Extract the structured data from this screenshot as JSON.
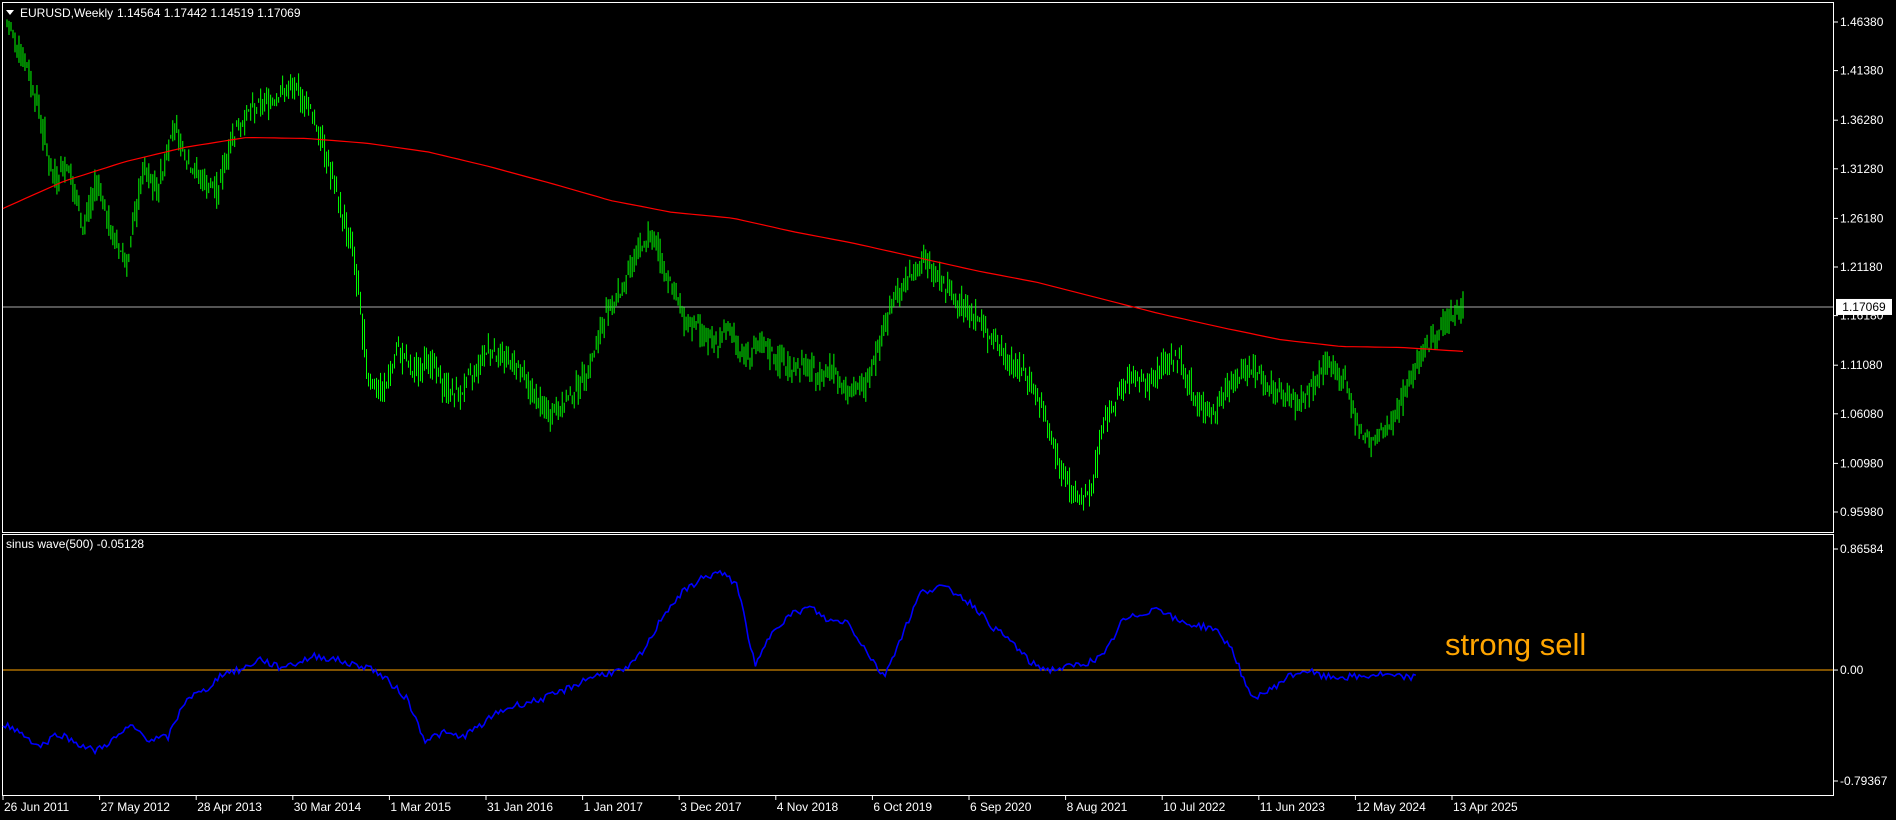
{
  "header": {
    "dropdown_icon": "triangle-down-icon",
    "symbol": "EURUSD,Weekly",
    "ohlc": "1.14564 1.17442 1.14519 1.17069"
  },
  "indicator": {
    "label": "sinus wave(500) -0.05128"
  },
  "current_price_label": "1.17069",
  "annotation": "strong sell",
  "colors": {
    "background": "#000000",
    "candles": "#00ff00",
    "moving_average": "#ff0000",
    "sinus_wave": "#0000ff",
    "zero_line": "#ffa500",
    "current_price_line": "#a9a9a9",
    "annotation": "#ffa500",
    "frame": "#ffffff"
  },
  "chart_data": [
    {
      "type": "line",
      "panel": "price",
      "series": [
        {
          "name": "EURUSD",
          "values": [
            1.46,
            1.43,
            1.38,
            1.3,
            1.32,
            1.25,
            1.3,
            1.24,
            1.22,
            1.31,
            1.29,
            1.36,
            1.32,
            1.3,
            1.29,
            1.35,
            1.37,
            1.38,
            1.39,
            1.395,
            1.38,
            1.34,
            1.28,
            1.23,
            1.1,
            1.08,
            1.13,
            1.1,
            1.12,
            1.09,
            1.08,
            1.1,
            1.13,
            1.12,
            1.11,
            1.08,
            1.06,
            1.07,
            1.09,
            1.12,
            1.17,
            1.19,
            1.23,
            1.245,
            1.2,
            1.16,
            1.15,
            1.13,
            1.15,
            1.12,
            1.13,
            1.12,
            1.11,
            1.11,
            1.1,
            1.11,
            1.08,
            1.09,
            1.13,
            1.18,
            1.2,
            1.22,
            1.2,
            1.18,
            1.17,
            1.15,
            1.13,
            1.11,
            1.1,
            1.06,
            1.01,
            0.98,
            0.97,
            1.05,
            1.08,
            1.1,
            1.09,
            1.11,
            1.12,
            1.08,
            1.06,
            1.08,
            1.1,
            1.11,
            1.09,
            1.08,
            1.07,
            1.09,
            1.11,
            1.1,
            1.04,
            1.03,
            1.05,
            1.08,
            1.12,
            1.14,
            1.16,
            1.17
          ]
        },
        {
          "name": "moving-average",
          "values": [
            1.272,
            1.3,
            1.32,
            1.335,
            1.345,
            1.344,
            1.339,
            1.33,
            1.315,
            1.298,
            1.28,
            1.268,
            1.262,
            1.248,
            1.236,
            1.222,
            1.208,
            1.196,
            1.18,
            1.164,
            1.15,
            1.137,
            1.13,
            1.129,
            1.125
          ]
        }
      ],
      "y_ticks": [
        "1.46380",
        "1.41380",
        "1.36280",
        "1.31280",
        "1.26180",
        "1.21180",
        "1.16180",
        "1.11080",
        "1.06080",
        "1.00980",
        "0.95980"
      ],
      "ylim": [
        0.9598,
        1.4638
      ],
      "current_price": 1.17069,
      "grid": false
    },
    {
      "type": "line",
      "panel": "indicator",
      "series": [
        {
          "name": "sinus wave(500)",
          "values": [
            -0.38,
            -0.45,
            -0.55,
            -0.45,
            -0.52,
            -0.58,
            -0.5,
            -0.4,
            -0.5,
            -0.48,
            -0.2,
            -0.15,
            -0.02,
            0.0,
            0.08,
            0.02,
            0.05,
            0.1,
            0.08,
            0.04,
            0.02,
            -0.08,
            -0.2,
            -0.5,
            -0.45,
            -0.48,
            -0.4,
            -0.3,
            -0.25,
            -0.22,
            -0.18,
            -0.12,
            -0.05,
            -0.02,
            0.0,
            0.15,
            0.4,
            0.55,
            0.65,
            0.7,
            0.62,
            0.02,
            0.3,
            0.4,
            0.45,
            0.35,
            0.35,
            0.15,
            -0.05,
            0.25,
            0.55,
            0.6,
            0.55,
            0.45,
            0.3,
            0.2,
            0.05,
            0.0,
            0.02,
            0.05,
            0.1,
            0.35,
            0.4,
            0.45,
            0.35,
            0.32,
            0.3,
            0.15,
            -0.2,
            -0.15,
            -0.05,
            0.0,
            -0.05,
            -0.05,
            -0.05,
            -0.03,
            -0.05,
            -0.05
          ],
          "x_span": [
            0,
            0.772
          ]
        }
      ],
      "y_ticks": [
        "0.86584",
        "0.00",
        "-0.79367"
      ],
      "ylim": [
        -0.79367,
        0.86584
      ],
      "zero_line": 0.0,
      "grid": false
    }
  ],
  "x_axis_labels": [
    "26 Jun 2011",
    "27 May 2012",
    "28 Apr 2013",
    "30 Mar 2014",
    "1 Mar 2015",
    "31 Jan 2016",
    "1 Jan 2017",
    "3 Dec 2017",
    "4 Nov 2018",
    "6 Oct 2019",
    "6 Sep 2020",
    "8 Aug 2021",
    "10 Jul 2022",
    "11 Jun 2023",
    "12 May 2024",
    "13 Apr 2025"
  ]
}
